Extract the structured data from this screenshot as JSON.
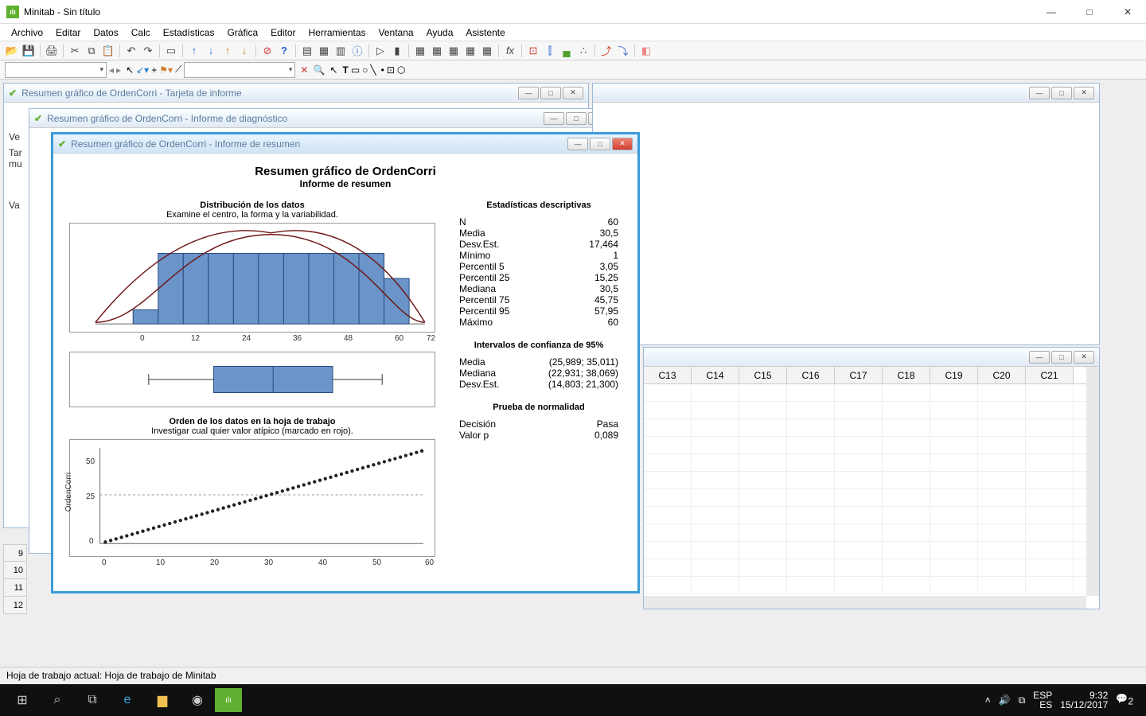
{
  "app": {
    "title": "Minitab - Sin título"
  },
  "menu": [
    "Archivo",
    "Editar",
    "Datos",
    "Calc",
    "Estadísticas",
    "Gráfica",
    "Editor",
    "Herramientas",
    "Ventana",
    "Ayuda",
    "Asistente"
  ],
  "windows": {
    "w1": "Resumen gráfico de OrdenCorri - Tarjeta de informe",
    "w2": "Resumen gráfico de OrdenCorri - Informe de diagnóstico",
    "w3": "Resumen gráfico de OrdenCorri - Informe de resumen"
  },
  "report": {
    "title": "Resumen gráfico de OrdenCorri",
    "subtitle": "Informe de resumen",
    "hist_title": "Distribución de los datos",
    "hist_sub": "Examine el centro, la forma y la variabilidad.",
    "order_title": "Orden de los datos en la hoja de trabajo",
    "order_sub": "Investigar cual quier valor atípico (marcado en rojo).",
    "ylab": "OrdenCorri"
  },
  "stats": {
    "h1": "Estadísticas descriptivas",
    "rows": [
      [
        "N",
        "60"
      ],
      [
        "Media",
        "30,5"
      ],
      [
        "Desv.Est.",
        "17,464"
      ],
      [
        "Mínimo",
        "1"
      ],
      [
        "Percentil 5",
        "3,05"
      ],
      [
        "Percentil 25",
        "15,25"
      ],
      [
        "Mediana",
        "30,5"
      ],
      [
        "Percentil 75",
        "45,75"
      ],
      [
        "Percentil 95",
        "57,95"
      ],
      [
        "Máximo",
        "60"
      ]
    ],
    "h2": "Intervalos de confianza de 95%",
    "ci": [
      [
        "Media",
        "(25,989; 35,011)"
      ],
      [
        "Mediana",
        "(22,931; 38,069)"
      ],
      [
        "Desv.Est.",
        "(14,803; 21,300)"
      ]
    ],
    "h3": "Prueba de normalidad",
    "norm": [
      [
        "Decisión",
        "Pasa"
      ],
      [
        "Valor p",
        "0,089"
      ]
    ]
  },
  "grid": {
    "cols": [
      "C13",
      "C14",
      "C15",
      "C16",
      "C17",
      "C18",
      "C19",
      "C20",
      "C21"
    ]
  },
  "side": {
    "labels": [
      "Ve",
      "Tar",
      "mu",
      "",
      "Va"
    ],
    "rownums": [
      "9",
      "10",
      "11",
      "12"
    ]
  },
  "status": "Hoja de trabajo actual: Hoja de trabajo de Minitab",
  "taskbar": {
    "lang": "ESP",
    "loc": "ES",
    "time": "9:32",
    "date": "15/12/2017",
    "n": "2"
  },
  "chart_data": [
    {
      "type": "bar",
      "title": "Distribución de los datos",
      "x_ticks": [
        0,
        12,
        24,
        36,
        48,
        60,
        72
      ],
      "bin_edges": [
        0,
        6,
        12,
        18,
        24,
        30,
        36,
        42,
        48,
        54,
        60,
        66
      ],
      "counts": [
        1,
        6,
        6,
        6,
        6,
        6,
        6,
        6,
        6,
        6,
        5
      ],
      "overlay": "normal_curve"
    },
    {
      "type": "boxplot",
      "min": 1,
      "q1": 15.25,
      "median": 30.5,
      "q3": 45.75,
      "max": 60
    },
    {
      "type": "scatter",
      "title": "Orden de los datos en la hoja de trabajo",
      "xlabel": "",
      "ylabel": "OrdenCorri",
      "x_ticks": [
        0,
        10,
        20,
        30,
        40,
        50,
        60
      ],
      "y_ticks": [
        0,
        25,
        50
      ],
      "x": [
        1,
        2,
        3,
        4,
        5,
        6,
        7,
        8,
        9,
        10,
        11,
        12,
        13,
        14,
        15,
        16,
        17,
        18,
        19,
        20,
        21,
        22,
        23,
        24,
        25,
        26,
        27,
        28,
        29,
        30,
        31,
        32,
        33,
        34,
        35,
        36,
        37,
        38,
        39,
        40,
        41,
        42,
        43,
        44,
        45,
        46,
        47,
        48,
        49,
        50,
        51,
        52,
        53,
        54,
        55,
        56,
        57,
        58,
        59,
        60
      ],
      "y": [
        1,
        2,
        3,
        4,
        5,
        6,
        7,
        8,
        9,
        10,
        11,
        12,
        13,
        14,
        15,
        16,
        17,
        18,
        19,
        20,
        21,
        22,
        23,
        24,
        25,
        26,
        27,
        28,
        29,
        30,
        31,
        32,
        33,
        34,
        35,
        36,
        37,
        38,
        39,
        40,
        41,
        42,
        43,
        44,
        45,
        46,
        47,
        48,
        49,
        50,
        51,
        52,
        53,
        54,
        55,
        56,
        57,
        58,
        59,
        60
      ],
      "ref_line_y": 30.5
    }
  ]
}
